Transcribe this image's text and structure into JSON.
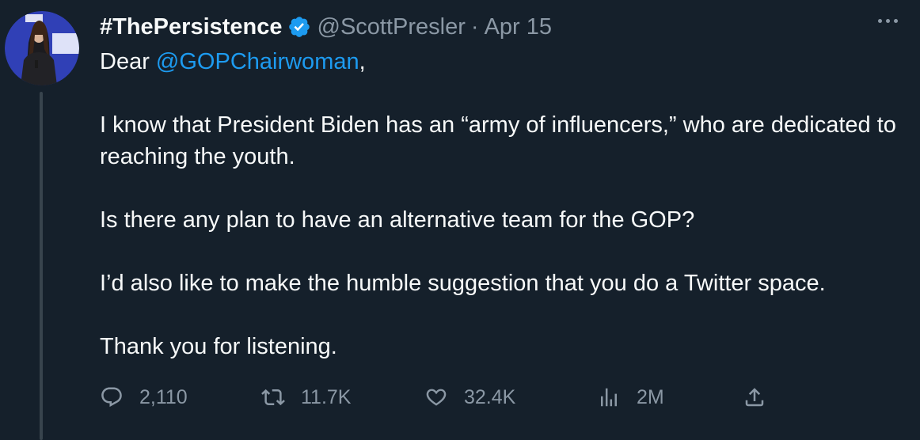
{
  "author": {
    "display_name": "#ThePersistence",
    "handle": "@ScottPresler",
    "separator": "·",
    "date": "Apr 15"
  },
  "tweet": {
    "salutation_prefix": "Dear ",
    "mention": "@GOPChairwoman",
    "salutation_suffix": ",",
    "paragraph_1": "I know that President Biden has an “army of influencers,” who are dedicated to reaching the youth.",
    "paragraph_2": "Is there any plan to have an alternative team for the GOP?",
    "paragraph_3": "I’d also like to make the humble suggestion that you do a Twitter space.",
    "paragraph_4": "Thank you for listening."
  },
  "metrics": {
    "replies": "2,110",
    "retweets": "11.7K",
    "likes": "32.4K",
    "views": "2M"
  },
  "icons": {
    "reply": "reply-icon",
    "retweet": "retweet-icon",
    "like": "heart-icon",
    "views": "views-icon",
    "share": "share-icon",
    "verified": "verified-badge-icon",
    "more": "more-icon"
  },
  "colors": {
    "background": "#15202b",
    "text": "#f7f9f9",
    "muted": "#8b98a5",
    "accent": "#1d9bf0",
    "thread_line": "#38444d"
  }
}
